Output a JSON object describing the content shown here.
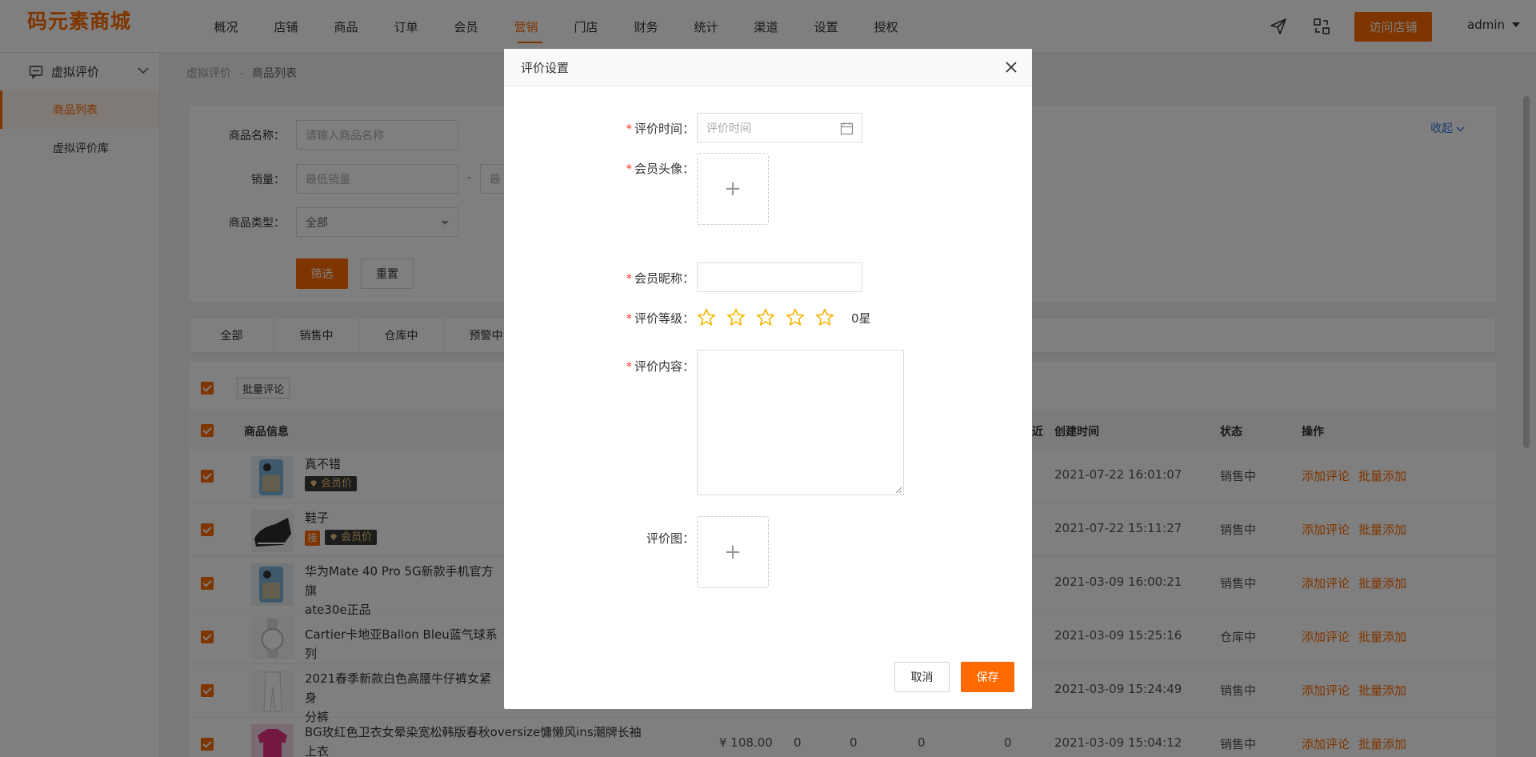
{
  "logo": {
    "text": "码元素商城"
  },
  "nav": {
    "items": [
      "概况",
      "店铺",
      "商品",
      "订单",
      "会员",
      "营销",
      "门店",
      "财务",
      "统计",
      "渠道",
      "设置",
      "授权"
    ],
    "active_index": 5,
    "visit_store": "访问店铺",
    "user": "admin"
  },
  "sidebar": {
    "group_label": "虚拟评价",
    "items": [
      {
        "label": "商品列表",
        "active": true
      },
      {
        "label": "虚拟评价库",
        "active": false
      }
    ]
  },
  "breadcrumb": {
    "root": "虚拟评价",
    "sep": "-",
    "current": "商品列表"
  },
  "filters": {
    "name_label": "商品名称：",
    "name_placeholder": "请输入商品名称",
    "sales_label": "销量：",
    "sales_min_placeholder": "最低销量",
    "sales_sep": "-",
    "sales_max_placeholder_partial": "最",
    "type_label": "商品类型：",
    "type_value": "全部",
    "filter_btn": "筛选",
    "reset_btn": "重置",
    "collapse": "收起"
  },
  "tabs": [
    "全部",
    "销售中",
    "仓库中",
    "预警中"
  ],
  "list": {
    "batch_comment": "批量评论",
    "headers": {
      "product": "商品信息",
      "partial_col": "近",
      "created": "创建时间",
      "status": "状态",
      "action": "操作"
    },
    "rows": [
      {
        "name": "真不错",
        "vip": true,
        "jie": false,
        "created": "2021-07-22 16:01:07",
        "status": "销售中"
      },
      {
        "name": "鞋子",
        "vip": true,
        "jie": true,
        "created": "2021-07-22 15:11:27",
        "status": "销售中"
      },
      {
        "name": "华为Mate 40 Pro 5G新款手机官方旗ate30e正品",
        "line1": "华为Mate 40 Pro 5G新款手机官方旗",
        "line2": "ate30e正品",
        "vip": false,
        "jie": false,
        "created": "2021-03-09 16:00:21",
        "status": "销售中"
      },
      {
        "name": "Cartier卡地亚Ballon Bleu蓝气球系列",
        "vip": false,
        "jie": false,
        "created": "2021-03-09 15:25:16",
        "status": "仓库中"
      },
      {
        "line1": "2021春季新款白色高腰牛仔裤女紧身",
        "line2": "分裤",
        "vip": false,
        "jie": false,
        "created": "2021-03-09 15:24:49",
        "status": "销售中"
      },
      {
        "line1": "BG玫红色卫衣女晕染宽松韩版春秋oversize慵懒风ins潮牌长袖",
        "line2": "上衣",
        "price": "¥ 108.00",
        "c1": "0",
        "c2": "0",
        "c3": "0",
        "c4": "0",
        "vip": false,
        "jie": false,
        "created": "2021-03-09 15:04:12",
        "status": "销售中"
      }
    ],
    "tag_vip": "会员价",
    "tag_jie": "接",
    "op_add": "添加评论",
    "op_batch": "批量添加"
  },
  "modal": {
    "title": "评价设置",
    "time_label": "评价时间：",
    "time_placeholder": "评价时间",
    "avatar_label": "会员头像：",
    "nickname_label": "会员昵称：",
    "rating_label": "评价等级：",
    "rating_value": "0星",
    "content_label": "评价内容：",
    "images_label": "评价图：",
    "upload_plus": "+",
    "cancel": "取消",
    "save": "保存"
  },
  "colors": {
    "accent": "#ff6a00",
    "link": "#2f7bd6",
    "star": "#f5b301"
  }
}
